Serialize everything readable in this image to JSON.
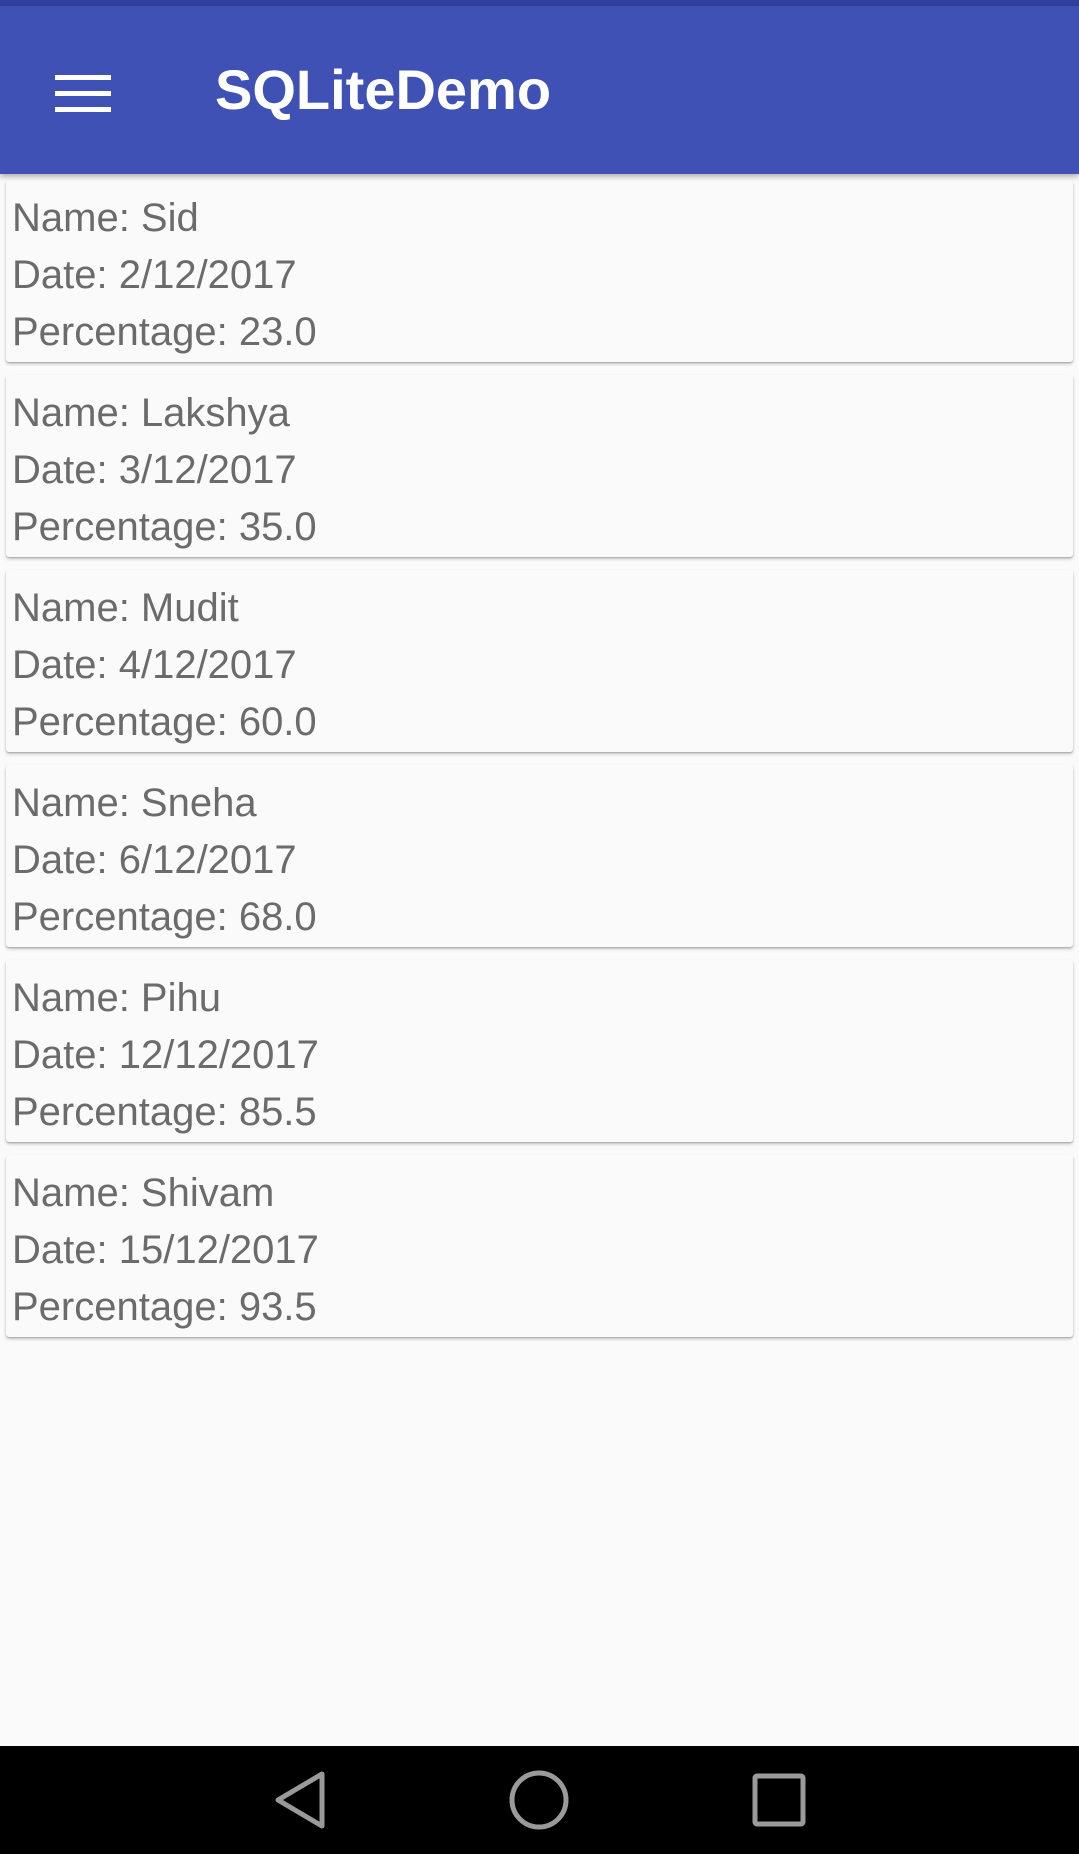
{
  "app_bar": {
    "title": "SQLiteDemo",
    "color": "#3f51b5",
    "menu_icon": "hamburger-menu-icon"
  },
  "records": [
    {
      "name": "Name: Sid",
      "date": "Date: 2/12/2017",
      "percentage": "Percentage: 23.0"
    },
    {
      "name": "Name: Lakshya",
      "date": "Date: 3/12/2017",
      "percentage": "Percentage: 35.0"
    },
    {
      "name": "Name: Mudit",
      "date": "Date: 4/12/2017",
      "percentage": "Percentage: 60.0"
    },
    {
      "name": "Name: Sneha",
      "date": "Date: 6/12/2017",
      "percentage": "Percentage: 68.0"
    },
    {
      "name": "Name: Pihu",
      "date": "Date: 12/12/2017",
      "percentage": "Percentage: 85.5"
    },
    {
      "name": "Name: Shivam",
      "date": "Date: 15/12/2017",
      "percentage": "Percentage: 93.5"
    }
  ],
  "nav_bar": {
    "icons": [
      "back-icon",
      "home-icon",
      "recents-icon"
    ]
  }
}
